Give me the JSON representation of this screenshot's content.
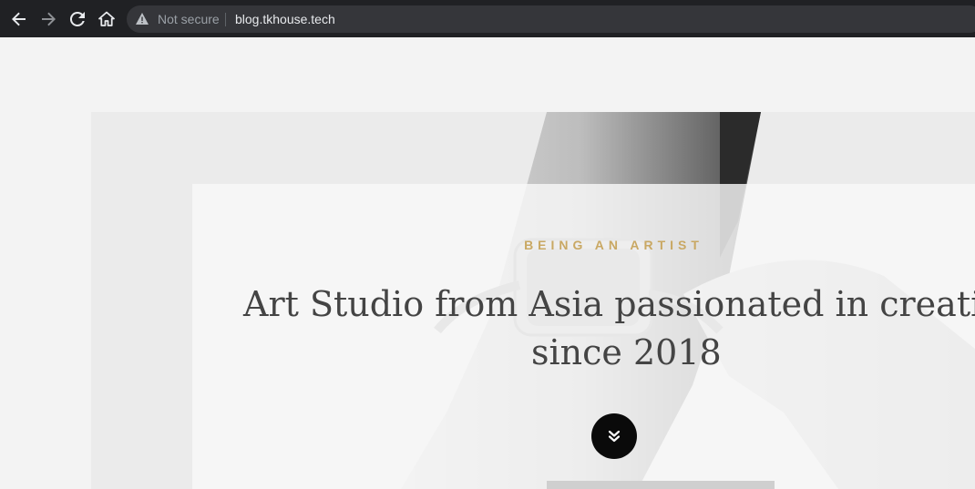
{
  "browser": {
    "back_icon": "arrow-left-icon",
    "forward_icon": "arrow-right-icon",
    "reload_icon": "reload-icon",
    "home_icon": "home-icon",
    "security_icon": "warning-triangle-icon",
    "security_text": "Not secure",
    "url": "blog.tkhouse.tech"
  },
  "hero": {
    "eyebrow": "BEING AN ARTIST",
    "headline_line1": "Art Studio from Asia passionated in creativity",
    "headline_line2": "since 2018",
    "scroll_icon": "double-chevron-down-icon",
    "accent_color": "#c9a863",
    "button_color": "#0a0a0a"
  }
}
